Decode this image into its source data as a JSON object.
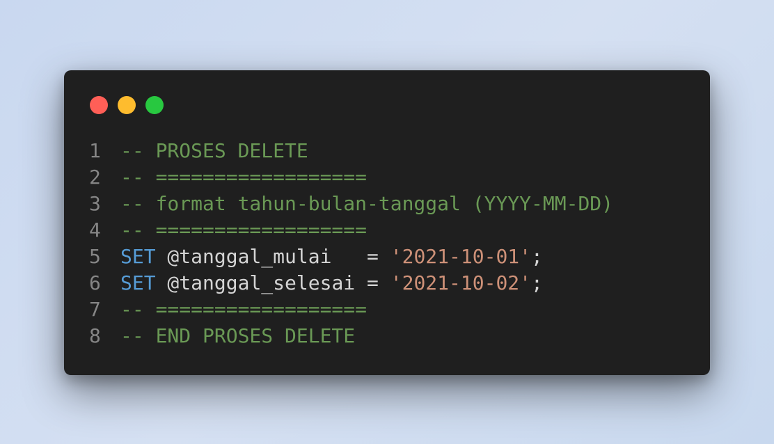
{
  "window": {
    "controls": [
      "close",
      "minimize",
      "maximize"
    ],
    "colors": {
      "background": "#1f1f1f",
      "close": "#ff5f57",
      "minimize": "#febc2e",
      "maximize": "#28c840",
      "comment": "#6a9955",
      "keyword": "#569cd6",
      "string": "#ce9178",
      "plain": "#d4d4d4",
      "line_number": "#858585"
    }
  },
  "code": {
    "language": "sql",
    "lines": [
      {
        "number": "1",
        "tokens": [
          {
            "type": "comment",
            "text": "-- PROSES DELETE"
          }
        ]
      },
      {
        "number": "2",
        "tokens": [
          {
            "type": "comment",
            "text": "-- =================="
          }
        ]
      },
      {
        "number": "3",
        "tokens": [
          {
            "type": "comment",
            "text": "-- format tahun-bulan-tanggal (YYYY-MM-DD)"
          }
        ]
      },
      {
        "number": "4",
        "tokens": [
          {
            "type": "comment",
            "text": "-- =================="
          }
        ]
      },
      {
        "number": "5",
        "tokens": [
          {
            "type": "keyword",
            "text": "SET"
          },
          {
            "type": "plain",
            "text": " @tanggal_mulai   = "
          },
          {
            "type": "string",
            "text": "'2021-10-01'"
          },
          {
            "type": "plain",
            "text": ";"
          }
        ]
      },
      {
        "number": "6",
        "tokens": [
          {
            "type": "keyword",
            "text": "SET"
          },
          {
            "type": "plain",
            "text": " @tanggal_selesai = "
          },
          {
            "type": "string",
            "text": "'2021-10-02'"
          },
          {
            "type": "plain",
            "text": ";"
          }
        ]
      },
      {
        "number": "7",
        "tokens": [
          {
            "type": "comment",
            "text": "-- =================="
          }
        ]
      },
      {
        "number": "8",
        "tokens": [
          {
            "type": "comment",
            "text": "-- END PROSES DELETE"
          }
        ]
      }
    ]
  }
}
